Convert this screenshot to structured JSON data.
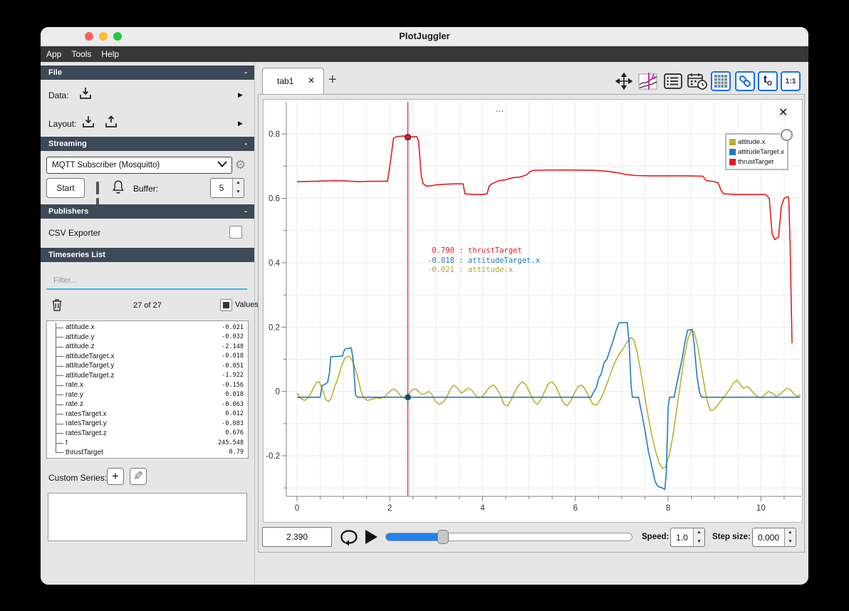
{
  "window": {
    "title": "PlotJuggler"
  },
  "menu": {
    "items": [
      "App",
      "Tools",
      "Help"
    ]
  },
  "icons": {
    "tab_close": "✕",
    "collapse": "-",
    "submenu_arrow": "▶",
    "gear": "⚙",
    "spin_up": "▲",
    "spin_down": "▼",
    "plus": "+",
    "pencil": "✎"
  },
  "sidebar": {
    "file": {
      "title": "File",
      "collapse": "-",
      "data_label": "Data:",
      "layout_label": "Layout:"
    },
    "streaming": {
      "title": "Streaming",
      "collapse": "-",
      "source": "MQTT Subscriber (Mosquitto)",
      "start": "Start",
      "buffer_label": "Buffer:",
      "buffer_value": "5"
    },
    "publishers": {
      "title": "Publishers",
      "collapse": "-",
      "csv_label": "CSV Exporter"
    },
    "timeseries": {
      "title": "Timeseries List",
      "filter_placeholder": "Filter...",
      "count": "27 of 27",
      "values_label": "Values",
      "custom_series_label": "Custom Series:",
      "items": [
        {
          "name": "attitude.x",
          "value": "-0.021"
        },
        {
          "name": "attitude.y",
          "value": "-0.032"
        },
        {
          "name": "attitude.z",
          "value": "-2.148"
        },
        {
          "name": "attitudeTarget.x",
          "value": "-0.018"
        },
        {
          "name": "attitudeTarget.y",
          "value": "-0.051"
        },
        {
          "name": "attitudeTarget.z",
          "value": "-1.922"
        },
        {
          "name": "rate.x",
          "value": "-0.156"
        },
        {
          "name": "rate.y",
          "value": "0.018"
        },
        {
          "name": "rate.z",
          "value": "-0.063"
        },
        {
          "name": "ratesTarget.x",
          "value": "0.012"
        },
        {
          "name": "ratesTarget.y",
          "value": "-0.083"
        },
        {
          "name": "ratesTarget.z",
          "value": "0.676"
        },
        {
          "name": "t",
          "value": "245.548"
        },
        {
          "name": "thrustTarget",
          "value": "0.79"
        }
      ]
    }
  },
  "tabs": {
    "active": "tab1",
    "add": "+"
  },
  "toolbar": {
    "tzero": "t",
    "tzero_sub": "O",
    "ratio": "1:1"
  },
  "plot": {
    "title": "...",
    "close": "✕",
    "legend": [
      {
        "label": "attitude.x",
        "color": "#b8b22e"
      },
      {
        "label": "attitudeTarget.x",
        "color": "#1f7bc4"
      },
      {
        "label": "thrustTarget",
        "color": "#e8191f"
      }
    ],
    "tooltip": [
      {
        "value": "0.790",
        "name": "thrustTarget",
        "color": "#e8191f"
      },
      {
        "value": "-0.018",
        "name": "attitudeTarget.x",
        "color": "#1f7bc4"
      },
      {
        "value": "-0.021",
        "name": "attitude.x",
        "color": "#b0a82c"
      }
    ]
  },
  "controls": {
    "time": "2.390",
    "slider_fraction": 0.232,
    "speed_label": "Speed:",
    "speed": "1.0",
    "step_label": "Step size:",
    "step": "0.000"
  },
  "chart_data": {
    "type": "line",
    "title": "...",
    "xlim": [
      -0.23,
      10.87
    ],
    "ylim": [
      -0.326,
      0.9
    ],
    "x_ticks": [
      0,
      2,
      4,
      6,
      8,
      10
    ],
    "x_minor_step": 0.5,
    "y_ticks": [
      0.8,
      0.6,
      0.4,
      0.2,
      0,
      -0.2
    ],
    "y_minor_step": 0.1,
    "grid": true,
    "legend_position": "top-right",
    "cursor": {
      "x": 2.39,
      "markers": [
        {
          "y": 0.79,
          "fill": "#e8191f",
          "stroke": "#222222"
        },
        {
          "y": -0.018,
          "fill": "#2a3f5c",
          "stroke": "#1f7bc4"
        }
      ]
    },
    "series": [
      {
        "name": "attitude.x",
        "color": "#b8b22e",
        "x": [
          0,
          0.08,
          0.16,
          0.24,
          0.32,
          0.42,
          0.48,
          0.55,
          0.62,
          0.68,
          0.74,
          0.8,
          0.88,
          0.96,
          1.04,
          1.12,
          1.2,
          1.3,
          1.38,
          1.44,
          1.52,
          1.6,
          1.7,
          1.8,
          1.9,
          2.0,
          2.08,
          2.16,
          2.24,
          2.32,
          2.4,
          2.48,
          2.56,
          2.62,
          2.7,
          2.78,
          2.84,
          2.9,
          2.98,
          3.06,
          3.14,
          3.22,
          3.3,
          3.38,
          3.46,
          3.54,
          3.6,
          3.68,
          3.76,
          3.84,
          3.92,
          4.0,
          4.08,
          4.16,
          4.24,
          4.3,
          4.38,
          4.46,
          4.54,
          4.62,
          4.7,
          4.78,
          4.86,
          4.94,
          5.02,
          5.1,
          5.18,
          5.26,
          5.34,
          5.42,
          5.5,
          5.58,
          5.66,
          5.74,
          5.82,
          5.9,
          5.98,
          6.06,
          6.14,
          6.22,
          6.3,
          6.38,
          6.46,
          6.54,
          6.62,
          6.72,
          6.82,
          6.92,
          7.02,
          7.12,
          7.2,
          7.26,
          7.32,
          7.4,
          7.48,
          7.56,
          7.64,
          7.72,
          7.8,
          7.88,
          7.94,
          8.02,
          8.1,
          8.18,
          8.26,
          8.34,
          8.42,
          8.5,
          8.56,
          8.64,
          8.72,
          8.8,
          8.86,
          8.92,
          9.0,
          9.08,
          9.16,
          9.24,
          9.32,
          9.4,
          9.48,
          9.56,
          9.62,
          9.7,
          9.76,
          9.84,
          9.92,
          10.0,
          10.08,
          10.16,
          10.24,
          10.32,
          10.4,
          10.48,
          10.56,
          10.64,
          10.72,
          10.8,
          10.85
        ],
        "y": [
          -0.005,
          -0.022,
          -0.028,
          -0.02,
          0.0,
          0.028,
          0.03,
          0.005,
          -0.025,
          -0.032,
          -0.02,
          0.01,
          0.04,
          0.08,
          0.105,
          0.11,
          0.095,
          0.05,
          0.0,
          -0.02,
          -0.028,
          -0.025,
          -0.02,
          -0.022,
          -0.015,
          0.0,
          0.008,
          0.0,
          -0.015,
          -0.022,
          -0.01,
          0.005,
          0.008,
          0.0,
          -0.01,
          -0.005,
          0.0,
          -0.008,
          -0.03,
          -0.04,
          -0.035,
          -0.02,
          0.005,
          0.02,
          0.01,
          -0.005,
          0.0,
          0.01,
          0.005,
          -0.01,
          -0.02,
          -0.015,
          0.0,
          0.015,
          0.02,
          0.01,
          -0.01,
          -0.04,
          -0.045,
          -0.025,
          0.0,
          0.02,
          0.03,
          0.02,
          -0.005,
          -0.03,
          -0.04,
          -0.025,
          0.0,
          0.025,
          0.03,
          0.015,
          -0.01,
          -0.035,
          -0.045,
          -0.03,
          -0.005,
          0.015,
          0.02,
          0.005,
          -0.02,
          -0.04,
          -0.042,
          -0.025,
          0.0,
          0.04,
          0.08,
          0.11,
          0.13,
          0.155,
          0.168,
          0.16,
          0.13,
          0.07,
          0.0,
          -0.07,
          -0.13,
          -0.18,
          -0.22,
          -0.24,
          -0.235,
          -0.2,
          -0.14,
          -0.06,
          0.02,
          0.1,
          0.16,
          0.19,
          0.185,
          0.14,
          0.07,
          0.0,
          -0.04,
          -0.06,
          -0.055,
          -0.04,
          -0.025,
          -0.01,
          0.005,
          0.025,
          0.035,
          0.02,
          0.01,
          0.015,
          0.01,
          -0.005,
          -0.015,
          -0.02,
          -0.01,
          0.0,
          -0.005,
          -0.015,
          -0.01,
          0.0,
          0.01,
          0.005,
          -0.01,
          -0.015,
          -0.01
        ]
      },
      {
        "name": "attitudeTarget.x",
        "color": "#1f7bc4",
        "x": [
          0,
          0.5,
          0.54,
          0.6,
          0.66,
          0.7,
          0.73,
          0.98,
          1.01,
          1.05,
          1.17,
          1.21,
          1.26,
          1.3,
          2.0,
          3.0,
          4.0,
          5.0,
          6.0,
          6.34,
          6.4,
          6.45,
          6.5,
          6.56,
          6.62,
          6.68,
          6.75,
          6.82,
          6.88,
          6.94,
          7.12,
          7.16,
          7.2,
          7.23,
          7.36,
          7.42,
          7.5,
          7.58,
          7.66,
          7.72,
          7.78,
          7.88,
          7.93,
          7.96,
          8.0,
          8.03,
          8.13,
          8.18,
          8.24,
          8.3,
          8.36,
          8.42,
          8.52,
          8.56,
          8.62,
          8.68,
          8.72,
          9.0,
          9.5,
          10.0,
          10.5,
          10.85
        ],
        "y": [
          -0.018,
          -0.018,
          0.018,
          0.022,
          0.028,
          0.06,
          0.108,
          0.11,
          0.125,
          0.133,
          0.135,
          0.1,
          -0.01,
          -0.018,
          -0.018,
          -0.018,
          -0.018,
          -0.018,
          -0.018,
          -0.018,
          0.0,
          0.01,
          0.04,
          0.055,
          0.09,
          0.1,
          0.13,
          0.16,
          0.19,
          0.213,
          0.214,
          0.15,
          0.02,
          -0.018,
          -0.018,
          -0.06,
          -0.12,
          -0.19,
          -0.24,
          -0.28,
          -0.295,
          -0.3,
          -0.305,
          -0.25,
          -0.05,
          -0.018,
          -0.018,
          0.02,
          0.06,
          0.1,
          0.15,
          0.19,
          0.193,
          0.15,
          0.05,
          -0.005,
          -0.018,
          -0.018,
          -0.018,
          -0.018,
          -0.018,
          -0.018
        ]
      },
      {
        "name": "thrustTarget",
        "color": "#e8191f",
        "x": [
          0,
          0.4,
          0.8,
          1.1,
          1.3,
          1.6,
          1.95,
          2.02,
          2.08,
          2.15,
          2.3,
          2.45,
          2.58,
          2.62,
          2.68,
          2.72,
          2.8,
          2.9,
          3.0,
          3.2,
          3.4,
          3.58,
          3.62,
          3.8,
          4.0,
          4.1,
          4.14,
          4.2,
          4.35,
          4.5,
          4.65,
          4.8,
          4.95,
          5.02,
          5.1,
          5.5,
          6.0,
          6.4,
          6.7,
          6.9,
          7.1,
          7.3,
          7.6,
          8.0,
          8.4,
          8.75,
          8.82,
          9.0,
          9.08,
          9.14,
          9.2,
          9.5,
          9.8,
          10.1,
          10.18,
          10.24,
          10.3,
          10.38,
          10.44,
          10.5,
          10.56,
          10.6,
          10.63,
          10.67
        ],
        "y": [
          0.652,
          0.653,
          0.655,
          0.654,
          0.652,
          0.653,
          0.653,
          0.72,
          0.787,
          0.792,
          0.794,
          0.791,
          0.792,
          0.78,
          0.67,
          0.645,
          0.638,
          0.639,
          0.642,
          0.644,
          0.645,
          0.645,
          0.614,
          0.612,
          0.612,
          0.614,
          0.638,
          0.645,
          0.655,
          0.658,
          0.664,
          0.666,
          0.673,
          0.683,
          0.687,
          0.688,
          0.688,
          0.687,
          0.684,
          0.68,
          0.674,
          0.671,
          0.67,
          0.67,
          0.67,
          0.669,
          0.655,
          0.652,
          0.648,
          0.625,
          0.614,
          0.612,
          0.612,
          0.612,
          0.6,
          0.49,
          0.472,
          0.48,
          0.575,
          0.6,
          0.605,
          0.603,
          0.45,
          0.15
        ]
      }
    ]
  }
}
